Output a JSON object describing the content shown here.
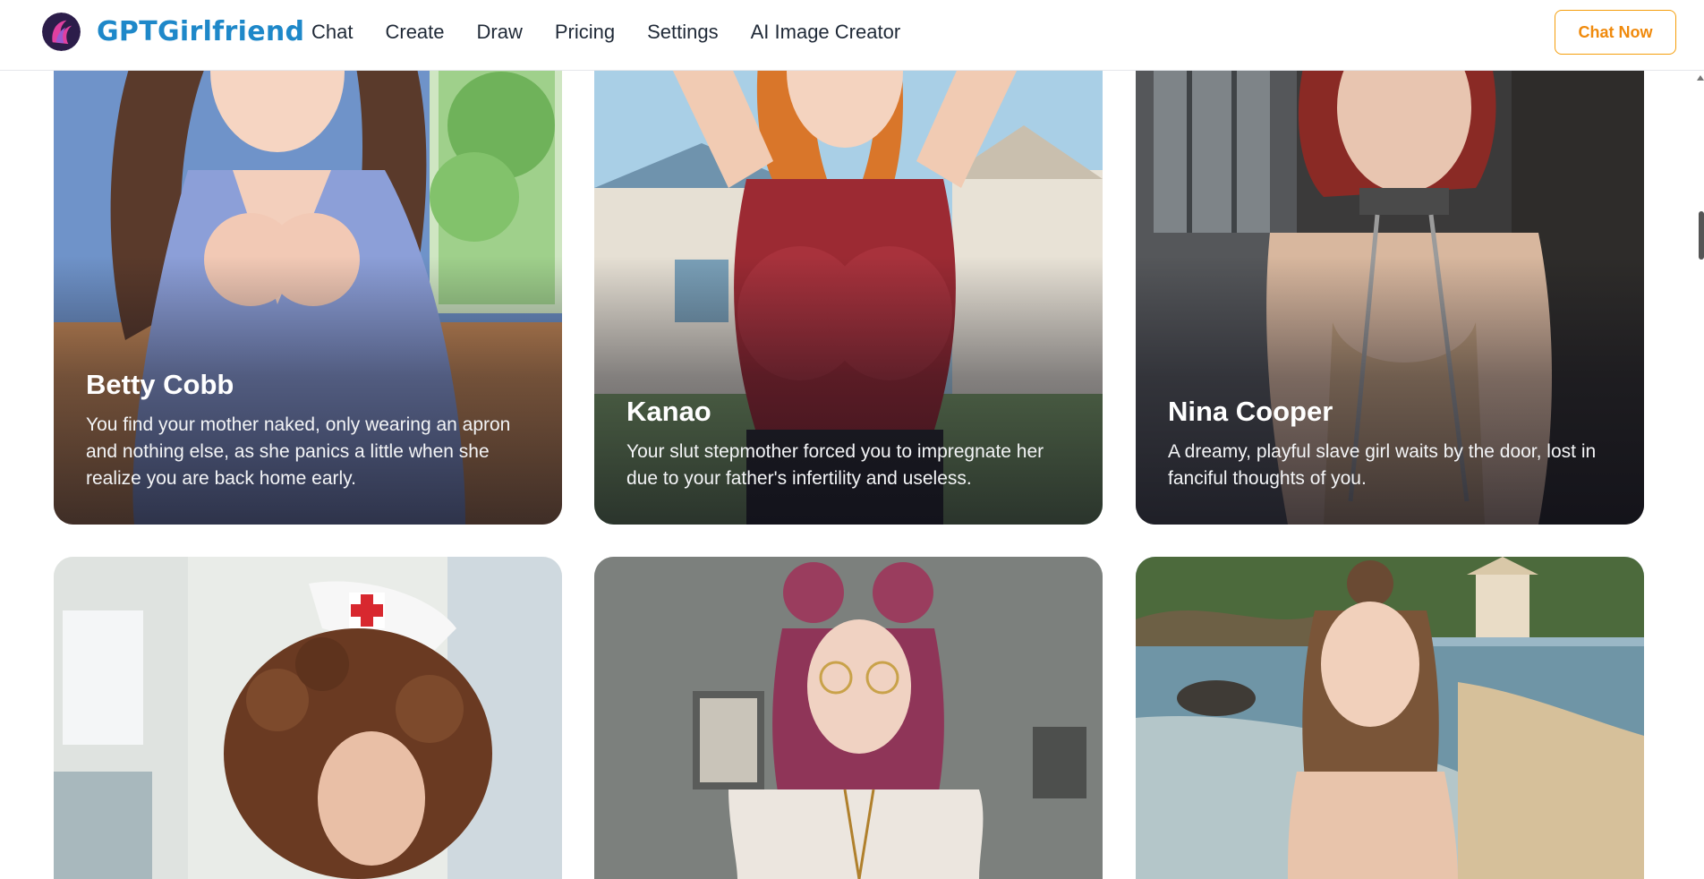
{
  "brand": {
    "name": "GPTGirlfriend",
    "color": "#1e88c9"
  },
  "nav": {
    "items": [
      "Chat",
      "Create",
      "Draw",
      "Pricing",
      "Settings",
      "AI Image Creator"
    ]
  },
  "cta": {
    "label": "Chat Now",
    "color": "#f08a0c"
  },
  "cards": [
    {
      "name": "Betty Cobb",
      "description": "You find your mother naked, only wearing an apron and nothing else, as she panics a little when she realize you are back home early.",
      "icon": "portrait-anime-office-woman"
    },
    {
      "name": "Kanao",
      "description": "Your slut stepmother forced you to impregnate her due to your father's infertility and useless.",
      "icon": "portrait-anime-redhead-tanktop"
    },
    {
      "name": "Nina Cooper",
      "description": "A dreamy, playful slave girl waits by the door, lost in fanciful thoughts of you.",
      "icon": "portrait-redhead-chained"
    },
    {
      "icon": "portrait-nurse-curly-hair"
    },
    {
      "icon": "portrait-pink-hair-glasses"
    },
    {
      "icon": "portrait-beach-woman"
    }
  ]
}
